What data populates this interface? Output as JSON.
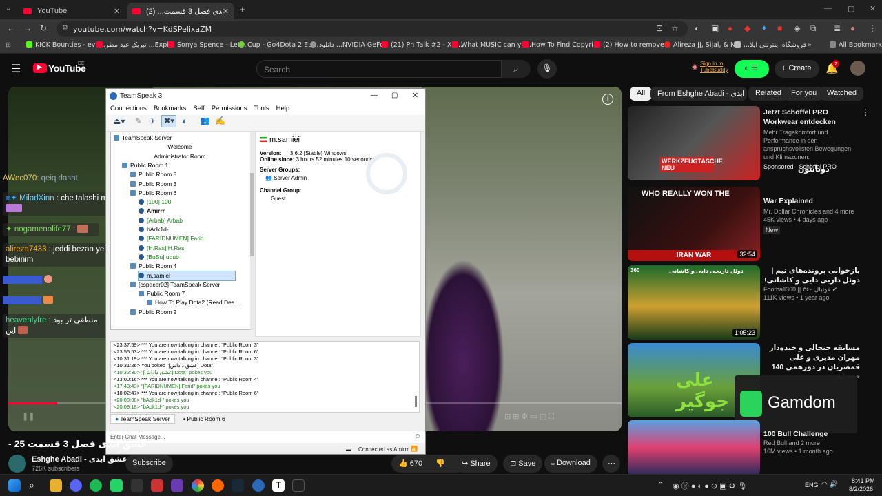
{
  "browser": {
    "tabs": [
      {
        "title": "YouTube"
      },
      {
        "title": "عشق ابدی فصل 3 قسمت... (2)"
      }
    ],
    "url": "youtube.com/watch?v=KdSPelixaZM",
    "bookmarks": [
      "KICK Bounties - eve...",
      "تبریک عید مطر ...Expl",
      "Sonya Spence - Let...",
      "Cup - Go4Dota 2 Eu...",
      "دانلود ...NVIDIA GeFor",
      "(21) Ph Talk #2 - XX...",
      "What MUSIC can yo...",
      "How To Find Copyri...",
      "(2) How to remove...",
      "Alireza JJ, Sijal, & N...",
      "...فروشگاه اینترنتی ایلا",
      "All Bookmarks"
    ]
  },
  "yt": {
    "logo": "YouTube",
    "region": "DE",
    "search_placeholder": "Search",
    "tubebuddy": "Sign in to TubeBuddy",
    "create": "Create",
    "notif_count": "2",
    "video_title": "عشق ابدی فصل 3 قسمت 25 -",
    "channel": "Eshghe Abadi - عشق ابدی",
    "subs": "726K subscribers",
    "subscribe": "Subscribe",
    "likes": "670",
    "share": "Share",
    "save": "Save",
    "download": "Download",
    "chips": [
      "All",
      "From Eshghe Abadi - عشق ابدی",
      "Related",
      "For you",
      "Watched"
    ],
    "recs": [
      {
        "title": "Jetzt Schöffel PRO Workwear entdecken",
        "desc": "Mehr Tragekomfort und Performance in den anspruchsvollsten Bewegungen und Klimazonen.",
        "channel": "Sponsored · Schöffel PRO",
        "thumb": "WERKZEUGTASCHE NEU"
      },
      {
        "title": "War Explained",
        "channel": "Mr. Dollar Chronicles and 4 more",
        "views": "45K views • 4 days ago",
        "badge": "New",
        "dur": "32:54",
        "thumb": "WHO REALLY WON THE",
        "thumb2": "IRAN WAR"
      },
      {
        "title": "بازخوانی پرونده‌های تیم | دوئل داربی دایی و کاشانی!",
        "channel": "Football360 || فوتبال ۳۶۰",
        "views": "111K views • 1 year ago",
        "dur": "1:05:23",
        "thumb": "دوئل تاریخی دایی و کاشانی"
      },
      {
        "title": "مسابقه جنجالی و خنده‌دار مهران مدیری و علی قمصریان در دورهمی 140",
        "channel": "خنده بازی",
        "thumb": "علی جوگیر"
      },
      {
        "title": "100 Bull Challenge",
        "channel": "Red Bull and 2 more",
        "views": "16M views • 1 month ago"
      }
    ],
    "overlay_donate": "دونانتون",
    "overlay_gamdom": "Gamdom"
  },
  "chat": [
    {
      "user": "AWec070",
      "msg": "qeiq dasht"
    },
    {
      "user": "MiladXinn",
      "msg": "che talashi mikone"
    },
    {
      "user": "nogamenolife77",
      "msg": ""
    },
    {
      "user": "alireza7433",
      "msg": "jeddi bezan yebar dg bebinim"
    },
    {
      "user": "heavenlyfre",
      "msg": "منطقی تر بود این"
    }
  ],
  "ts": {
    "title": "TeamSpeak 3",
    "menu": [
      "Connections",
      "Bookmarks",
      "Self",
      "Permissions",
      "Tools",
      "Help"
    ],
    "tree": [
      {
        "t": "TeamSpeak Server",
        "lvl": 0
      },
      {
        "t": "Welcome",
        "lvl": 3
      },
      {
        "t": "Administrator Room",
        "lvl": 3
      },
      {
        "t": "Public Room 1",
        "lvl": 1
      },
      {
        "t": "Public Room 5",
        "lvl": 2
      },
      {
        "t": "Public Room 3",
        "lvl": 2
      },
      {
        "t": "Public Room 6",
        "lvl": 2
      },
      {
        "t": "[100] 100",
        "lvl": 3,
        "c": "grn"
      },
      {
        "t": "Amirrr",
        "lvl": 3,
        "c": "b"
      },
      {
        "t": "[Arbab] Arbab",
        "lvl": 3,
        "c": "grn"
      },
      {
        "t": "bAdk1d-",
        "lvl": 3
      },
      {
        "t": "[FARIDNUMEN] Farid",
        "lvl": 3,
        "c": "grn"
      },
      {
        "t": "[H.Ras] H.Ras",
        "lvl": 3,
        "c": "grn"
      },
      {
        "t": "[BuBu] ubub",
        "lvl": 3,
        "c": "grn"
      },
      {
        "t": "Public Room 4",
        "lvl": 2
      },
      {
        "t": "m.samiei",
        "lvl": 3,
        "sel": true
      },
      {
        "t": "[cspacer02] TeamSpeak Server",
        "lvl": 2
      },
      {
        "t": "Public Room 7",
        "lvl": 3
      },
      {
        "t": "How To Play Dota2 (Read Des...",
        "lvl": 4
      },
      {
        "t": "Public Room 2",
        "lvl": 2
      }
    ],
    "info": {
      "name": "m.samiei",
      "version_label": "Version:",
      "version": "3.6.2 [Stable] Windows",
      "online_label": "Online since:",
      "online": "3 hours 52 minutes 10 seconds",
      "sg_label": "Server Groups:",
      "sg": "Server Admin",
      "cg_label": "Channel Group:",
      "cg": "Guest"
    },
    "log": [
      "<23:37:59> *** You are now talking in channel: \"Public Room 3\"",
      "<23:55:53> *** You are now talking in channel: \"Public Room 6\"",
      "<10:31:19> *** You are now talking in channel: \"Public Room 3\"",
      "<10:31:26> You poked \"[عشق داداش] Dota\".",
      "<10:32:30> \"[عشق داداش] Dota\" pokes you",
      "<13:00:16> *** You are now talking in channel: \"Public Room 4\"",
      "<17:43:43> \"[FARIDNUMEN] Farid\" pokes you",
      "<18:02:47> *** You are now talking in channel: \"Public Room 6\"",
      "<20:09:08> \"bAdk1d-\" pokes you",
      "<20:09:18> \"bAdk1d-\" pokes you"
    ],
    "tab_server": "TeamSpeak Server",
    "tab_channel": "Public Room 6",
    "input_placeholder": "Enter Chat Message...",
    "status": "Connected as Amirrr"
  },
  "taskbar": {
    "lang": "ENG",
    "time": "8:41 PM",
    "date": "8/2/2026"
  }
}
